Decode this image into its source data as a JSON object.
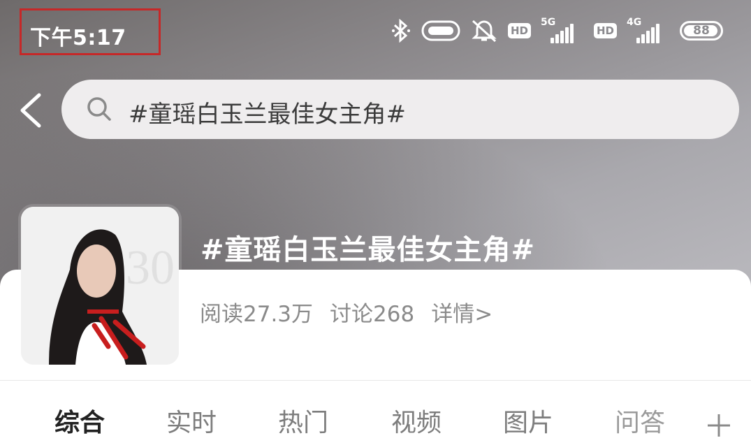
{
  "status_bar": {
    "time": "下午5:17",
    "icons": [
      "bluetooth-icon",
      "nfc-icon",
      "mute-icon",
      "hd-icon",
      "signal-5g-icon",
      "hd-icon",
      "signal-4g-icon",
      "battery-icon"
    ],
    "hd_label": "HD",
    "net1": "5G",
    "net2": "4G",
    "battery": "88"
  },
  "search": {
    "query": "#童瑶白玉兰最佳女主角#"
  },
  "topic": {
    "title": "#童瑶白玉兰最佳女主角#",
    "reads": "阅读27.3万",
    "discussions": "讨论268",
    "details_link": "详情>"
  },
  "tabs": [
    {
      "label": "综合",
      "active": true
    },
    {
      "label": "实时"
    },
    {
      "label": "热门"
    },
    {
      "label": "视频"
    },
    {
      "label": "图片"
    },
    {
      "label": "问答"
    }
  ]
}
